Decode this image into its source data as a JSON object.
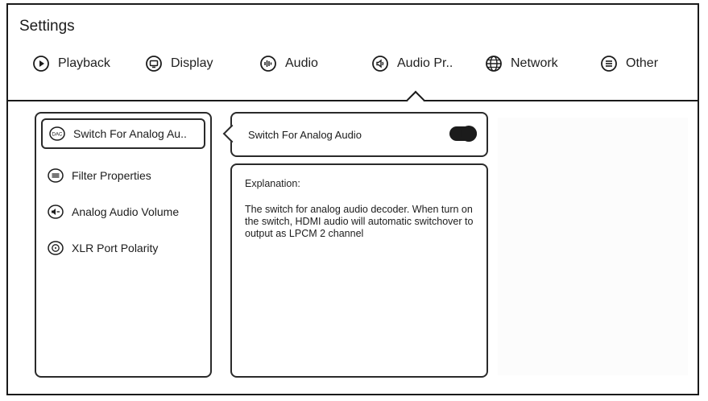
{
  "header": {
    "title": "Settings"
  },
  "tabs": [
    {
      "label": "Playback",
      "icon": "play-circle-icon"
    },
    {
      "label": "Display",
      "icon": "display-icon"
    },
    {
      "label": "Audio",
      "icon": "audio-icon"
    },
    {
      "label": "Audio Pr..",
      "icon": "speaker-icon"
    },
    {
      "label": "Network",
      "icon": "globe-icon"
    },
    {
      "label": "Other",
      "icon": "menu-circle-icon"
    }
  ],
  "menu": {
    "items": [
      {
        "label": "Switch For Analog Au..",
        "icon": "dac-icon",
        "selected": true
      },
      {
        "label": "Filter Properties",
        "icon": "filter-icon",
        "selected": false
      },
      {
        "label": "Analog Audio Volume",
        "icon": "volume-icon",
        "selected": false
      },
      {
        "label": "XLR Port Polarity",
        "icon": "xlr-icon",
        "selected": false
      }
    ]
  },
  "detail": {
    "switch_label": "Switch For Analog Audio",
    "switch_on": true,
    "explanation_title": "Explanation:",
    "explanation_text": "The switch for analog audio decoder. When turn on the switch, HDMI audio will automatic switchover to output as LPCM 2 channel"
  },
  "colors": {
    "foreground": "#1b1b1b",
    "background": "#ffffff"
  }
}
